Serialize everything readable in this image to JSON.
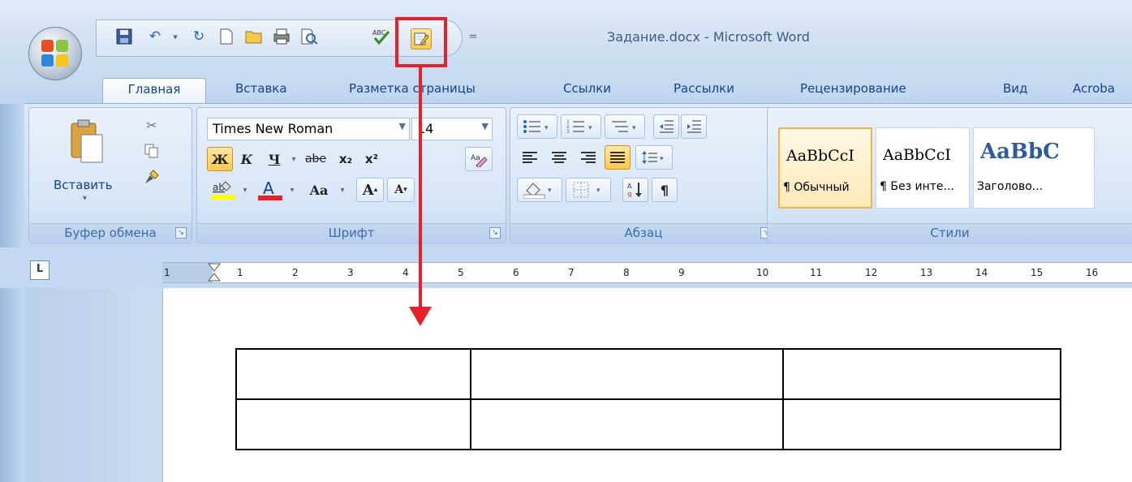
{
  "window": {
    "title": "Задание.docx - Microsoft Word"
  },
  "tabs": [
    {
      "label": "Главная"
    },
    {
      "label": "Вставка"
    },
    {
      "label": "Разметка страницы"
    },
    {
      "label": "Ссылки"
    },
    {
      "label": "Рассылки"
    },
    {
      "label": "Рецензирование"
    },
    {
      "label": "Вид"
    },
    {
      "label": "Acroba"
    }
  ],
  "clipboard": {
    "paste_label": "Вставить",
    "group_label": "Буфер обмена"
  },
  "font": {
    "family_value": "Times New Roman",
    "size_value": "14",
    "bold_glyph": "Ж",
    "italic_glyph": "К",
    "underline_glyph": "Ч",
    "strike_glyph": "abe",
    "subscript_glyph": "x₂",
    "superscript_glyph": "x²",
    "case_glyph": "Aa",
    "grow_glyph": "A",
    "shrink_glyph": "A",
    "group_label": "Шрифт",
    "colors": {
      "highlight": "#ffff00",
      "font_color": "#e8202a"
    }
  },
  "paragraph": {
    "group_label": "Абзац",
    "pilcrow": "¶"
  },
  "styles": {
    "group_label": "Стили",
    "cards": [
      {
        "sample": "AaBbCcI",
        "name": "¶ Обычный"
      },
      {
        "sample": "AaBbCcI",
        "name": "¶ Без инте..."
      },
      {
        "sample": "AaBbC",
        "name": "Заголово..."
      }
    ]
  },
  "ruler": {
    "corner_glyph": "L",
    "numbers": [
      "1",
      "1",
      "2",
      "3",
      "4",
      "5",
      "6",
      "7",
      "8",
      "9",
      "10",
      "11",
      "12",
      "13",
      "14",
      "15",
      "16"
    ]
  },
  "document": {
    "table": {
      "rows": 2,
      "columns": 3
    }
  },
  "annotation_color": "#e8202a"
}
